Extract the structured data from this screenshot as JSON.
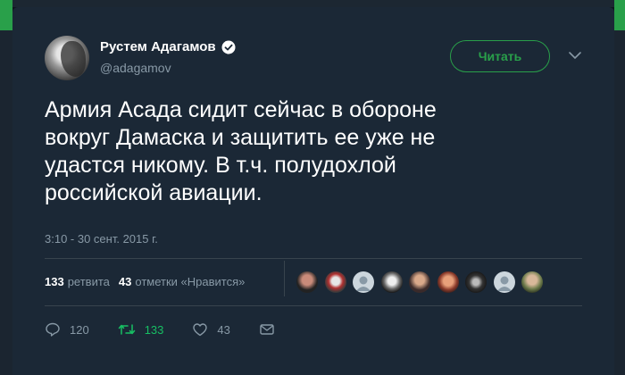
{
  "tweet": {
    "author_name": "Рустем Адагамов",
    "author_handle": "@adagamov",
    "follow_label": "Читать",
    "text_lines": [
      "Армия Асада сидит сейчас в обороне",
      "вокруг Дамаска и защитить ее уже не",
      "удастся никому. В т.ч. полудохлой",
      "российской авиации."
    ],
    "timestamp": "3:10 - 30 сент. 2015 г.",
    "retweets_count": "133",
    "retweets_label": "ретвита",
    "likes_count": "43",
    "likes_label": "отметки «Нравится»",
    "actions": {
      "reply_count": "120",
      "retweet_count": "133",
      "like_count": "43"
    }
  },
  "colors": {
    "background": "#1b2836",
    "accent_green": "#29a04a",
    "secondary_text": "#8899a6",
    "retweet_active": "#17bf63"
  },
  "icons": [
    "verified-badge-icon",
    "chevron-down-icon",
    "reply-icon",
    "retweet-icon",
    "like-icon",
    "message-icon"
  ]
}
